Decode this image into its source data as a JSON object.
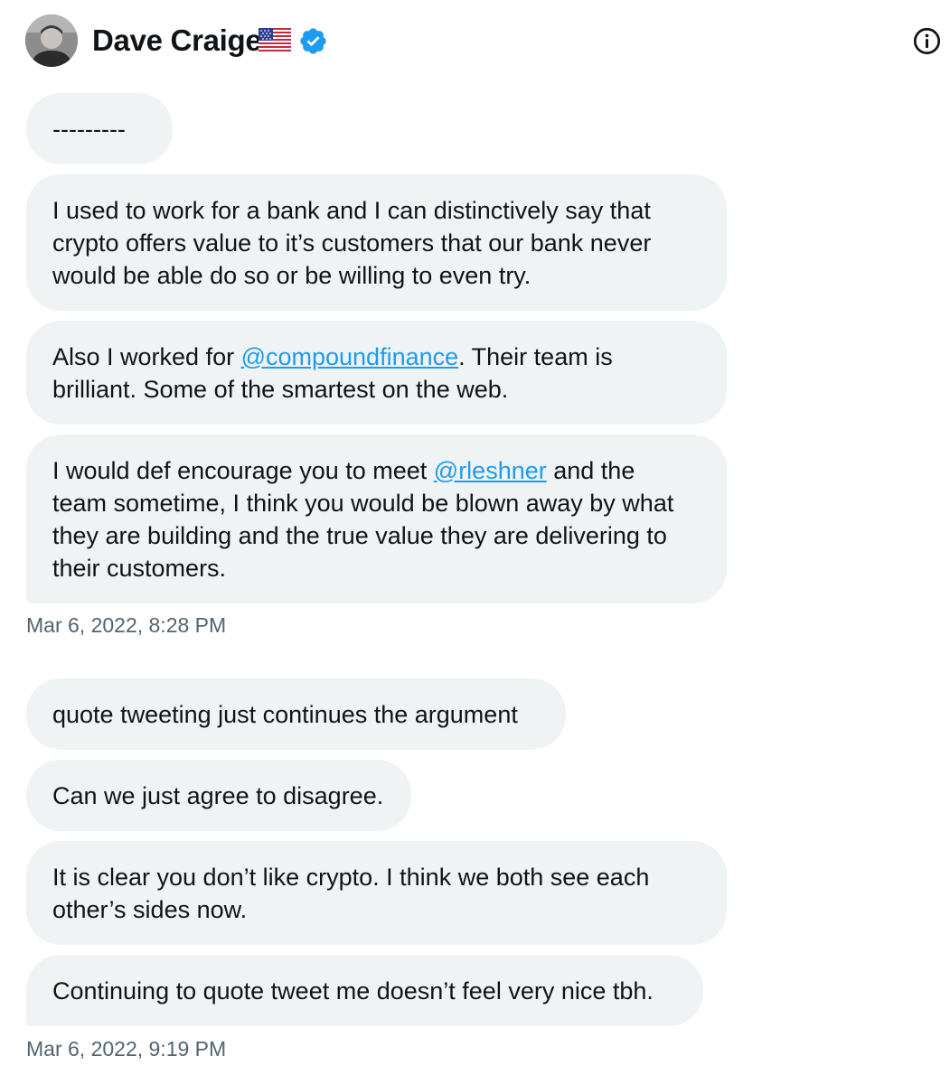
{
  "header": {
    "name": "Dave Craige",
    "flag_icon": "us-flag-icon",
    "verified_icon": "verified-badge-icon",
    "info_icon": "info-icon",
    "accent": "#1d9bf0"
  },
  "groups": [
    {
      "messages": [
        {
          "lines": [
            "---------"
          ]
        },
        {
          "lines": [
            "I used to work for a bank and I can distinctively say that",
            "crypto offers value to it’s customers that our bank never",
            "would be able do so or be willing to even try."
          ]
        },
        {
          "line1_before": "Also I worked for ",
          "line1_mention": "@compoundfinance",
          "line1_after": ".  Their team is",
          "line2": "brilliant.  Some of the smartest on the web."
        },
        {
          "line1_before": "I would def encourage you to meet ",
          "line1_mention": "@rleshner",
          "line1_after": " and the",
          "line2": "team sometime, I think you would be blown away by what",
          "line3": "they are building and the true value they are delivering to",
          "line4": "their customers."
        }
      ],
      "timestamp": "Mar 6, 2022, 8:28 PM"
    },
    {
      "messages": [
        {
          "lines": [
            "quote tweeting just continues the argument"
          ]
        },
        {
          "lines": [
            "Can we just agree to disagree."
          ]
        },
        {
          "lines": [
            "It is clear you don’t like crypto.  I think we both see each",
            "other’s sides now."
          ]
        },
        {
          "lines": [
            "Continuing to quote tweet me doesn’t feel very nice tbh."
          ]
        }
      ],
      "timestamp": "Mar 6, 2022, 9:19 PM"
    }
  ]
}
